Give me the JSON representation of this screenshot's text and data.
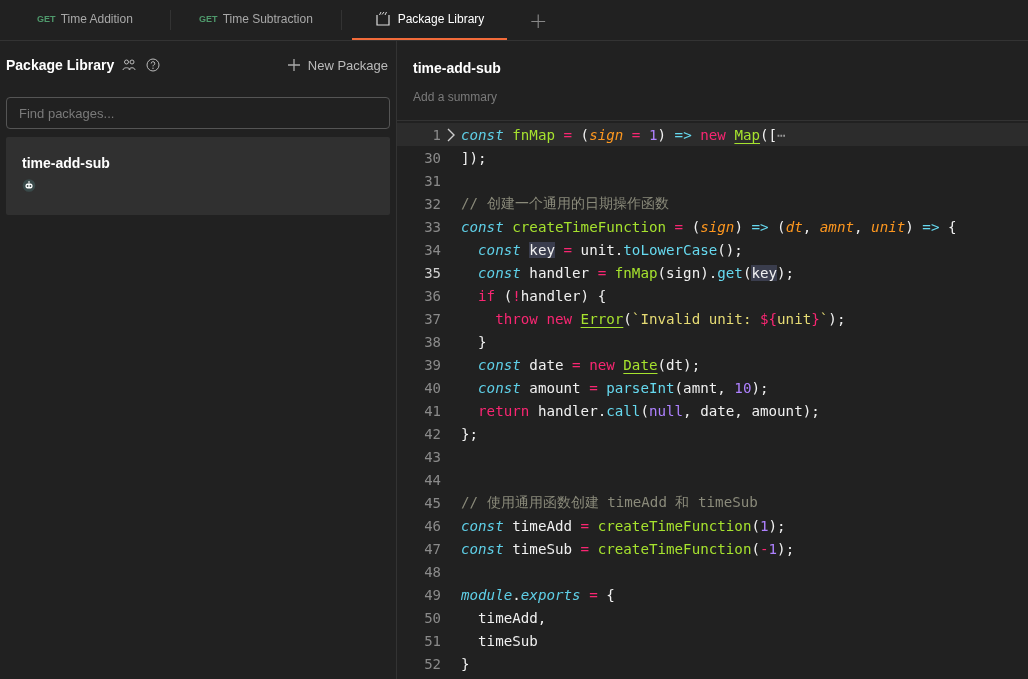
{
  "tabs": [
    {
      "kind": "request",
      "method": "GET",
      "label": "Time Addition",
      "selected": false
    },
    {
      "kind": "request",
      "method": "GET",
      "label": "Time Subtraction",
      "selected": false
    },
    {
      "kind": "package",
      "label": "Package Library",
      "selected": true
    }
  ],
  "new_tab": "+",
  "sidebar": {
    "title": "Package Library",
    "new_button": "New Package",
    "search": {
      "placeholder": "Find packages..."
    },
    "items": [
      {
        "name": "time-add-sub",
        "selected": true
      }
    ]
  },
  "editor": {
    "title": "time-add-sub",
    "summary_placeholder": "Add a summary",
    "lines": [
      {
        "number": "1",
        "folded": true,
        "highlighted": true,
        "active": false,
        "tokens": [
          {
            "kind": "kw",
            "text": "const"
          },
          {
            "kind": "fn",
            "text": " fnMap"
          },
          {
            "kind": "op",
            "text": " ="
          },
          {
            "kind": "pl",
            "text": " ("
          },
          {
            "kind": "par",
            "text": "sign"
          },
          {
            "kind": "op",
            "text": " ="
          },
          {
            "kind": "num",
            "text": " 1"
          },
          {
            "kind": "pl",
            "text": ")"
          },
          {
            "kind": "mth",
            "text": " =>"
          },
          {
            "kind": "kw2",
            "text": " new "
          },
          {
            "kind": "cls",
            "text": "Map"
          },
          {
            "kind": "pl",
            "text": "(["
          },
          {
            "kind": "dim",
            "text": "⋯"
          }
        ]
      },
      {
        "number": "30",
        "folded": false,
        "highlighted": false,
        "active": false,
        "tokens": [
          {
            "kind": "pl",
            "text": "]);"
          }
        ]
      },
      {
        "number": "31",
        "folded": false,
        "highlighted": false,
        "active": false
      },
      {
        "number": "32",
        "folded": false,
        "highlighted": false,
        "active": false,
        "tokens": [
          {
            "kind": "cm",
            "text": "// 创建一个通用的日期操作函数"
          }
        ]
      },
      {
        "number": "33",
        "folded": false,
        "highlighted": false,
        "active": false,
        "tokens": [
          {
            "kind": "kw",
            "text": "const"
          },
          {
            "kind": "fn",
            "text": " createTimeFunction"
          },
          {
            "kind": "op",
            "text": " ="
          },
          {
            "kind": "pl",
            "text": " ("
          },
          {
            "kind": "par",
            "text": "sign"
          },
          {
            "kind": "pl",
            "text": ")"
          },
          {
            "kind": "mth",
            "text": " =>"
          },
          {
            "kind": "pl",
            "text": " ("
          },
          {
            "kind": "par",
            "text": "dt"
          },
          {
            "kind": "pl",
            "text": ","
          },
          {
            "kind": "par",
            "text": " amnt"
          },
          {
            "kind": "pl",
            "text": ","
          },
          {
            "kind": "par",
            "text": " unit"
          },
          {
            "kind": "pl",
            "text": ")"
          },
          {
            "kind": "mth",
            "text": " =>"
          },
          {
            "kind": "pl",
            "text": " {"
          }
        ]
      },
      {
        "number": "34",
        "folded": false,
        "highlighted": false,
        "active": false,
        "tokens": [
          {
            "kind": "kw",
            "text": "  const "
          },
          {
            "kind": "hl",
            "text": "key"
          },
          {
            "kind": "op",
            "text": " ="
          },
          {
            "kind": "pl",
            "text": " unit."
          },
          {
            "kind": "mth",
            "text": "toLowerCase"
          },
          {
            "kind": "pl",
            "text": "();"
          }
        ]
      },
      {
        "number": "35",
        "folded": false,
        "highlighted": false,
        "active": true,
        "tokens": [
          {
            "kind": "kw",
            "text": "  const"
          },
          {
            "kind": "pl",
            "text": " handler"
          },
          {
            "kind": "op",
            "text": " ="
          },
          {
            "kind": "fn",
            "text": " fnMap"
          },
          {
            "kind": "pl",
            "text": "(sign)."
          },
          {
            "kind": "mth",
            "text": "get"
          },
          {
            "kind": "pl",
            "text": "("
          },
          {
            "kind": "hl",
            "text": "key"
          },
          {
            "kind": "pl",
            "text": ");"
          }
        ]
      },
      {
        "number": "36",
        "folded": false,
        "highlighted": false,
        "active": false,
        "tokens": [
          {
            "kind": "kw2",
            "text": "  if"
          },
          {
            "kind": "pl",
            "text": " ("
          },
          {
            "kind": "op",
            "text": "!"
          },
          {
            "kind": "pl",
            "text": "handler) {"
          }
        ]
      },
      {
        "number": "37",
        "folded": false,
        "highlighted": false,
        "active": false,
        "tokens": [
          {
            "kind": "kw2",
            "text": "    throw new "
          },
          {
            "kind": "cls",
            "text": "Error"
          },
          {
            "kind": "pl",
            "text": "("
          },
          {
            "kind": "str",
            "text": "`Invalid unit: "
          },
          {
            "kind": "op",
            "text": "${"
          },
          {
            "kind": "str",
            "text": "unit"
          },
          {
            "kind": "op",
            "text": "}"
          },
          {
            "kind": "str",
            "text": "`"
          },
          {
            "kind": "pl",
            "text": ");"
          }
        ]
      },
      {
        "number": "38",
        "folded": false,
        "highlighted": false,
        "active": false,
        "tokens": [
          {
            "kind": "pl",
            "text": "  }"
          }
        ]
      },
      {
        "number": "39",
        "folded": false,
        "highlighted": false,
        "active": false,
        "tokens": [
          {
            "kind": "kw",
            "text": "  const"
          },
          {
            "kind": "pl",
            "text": " date"
          },
          {
            "kind": "op",
            "text": " ="
          },
          {
            "kind": "kw2",
            "text": " new "
          },
          {
            "kind": "cls",
            "text": "Date"
          },
          {
            "kind": "pl",
            "text": "(dt);"
          }
        ]
      },
      {
        "number": "40",
        "folded": false,
        "highlighted": false,
        "active": false,
        "tokens": [
          {
            "kind": "kw",
            "text": "  const"
          },
          {
            "kind": "pl",
            "text": " amount"
          },
          {
            "kind": "op",
            "text": " ="
          },
          {
            "kind": "mth",
            "text": " parseInt"
          },
          {
            "kind": "pl",
            "text": "(amnt,"
          },
          {
            "kind": "num",
            "text": " 10"
          },
          {
            "kind": "pl",
            "text": ");"
          }
        ]
      },
      {
        "number": "41",
        "folded": false,
        "highlighted": false,
        "active": false,
        "tokens": [
          {
            "kind": "kw2",
            "text": "  return"
          },
          {
            "kind": "pl",
            "text": " handler."
          },
          {
            "kind": "mth",
            "text": "call"
          },
          {
            "kind": "pl",
            "text": "("
          },
          {
            "kind": "num",
            "text": "null"
          },
          {
            "kind": "pl",
            "text": ", date, amount);"
          }
        ]
      },
      {
        "number": "42",
        "folded": false,
        "highlighted": false,
        "active": false,
        "tokens": [
          {
            "kind": "pl",
            "text": "};"
          }
        ]
      },
      {
        "number": "43",
        "folded": false,
        "highlighted": false,
        "active": false
      },
      {
        "number": "44",
        "folded": false,
        "highlighted": false,
        "active": false
      },
      {
        "number": "45",
        "folded": false,
        "highlighted": false,
        "active": false,
        "tokens": [
          {
            "kind": "cm",
            "text": "// 使用通用函数创建 timeAdd 和 timeSub"
          }
        ]
      },
      {
        "number": "46",
        "folded": false,
        "highlighted": false,
        "active": false,
        "tokens": [
          {
            "kind": "kw",
            "text": "const"
          },
          {
            "kind": "pl",
            "text": " timeAdd"
          },
          {
            "kind": "op",
            "text": " ="
          },
          {
            "kind": "fn",
            "text": " createTimeFunction"
          },
          {
            "kind": "pl",
            "text": "("
          },
          {
            "kind": "num",
            "text": "1"
          },
          {
            "kind": "pl",
            "text": ");"
          }
        ]
      },
      {
        "number": "47",
        "folded": false,
        "highlighted": false,
        "active": false,
        "tokens": [
          {
            "kind": "kw",
            "text": "const"
          },
          {
            "kind": "pl",
            "text": " timeSub"
          },
          {
            "kind": "op",
            "text": " ="
          },
          {
            "kind": "fn",
            "text": " createTimeFunction"
          },
          {
            "kind": "pl",
            "text": "("
          },
          {
            "kind": "op",
            "text": "-"
          },
          {
            "kind": "num",
            "text": "1"
          },
          {
            "kind": "pl",
            "text": ");"
          }
        ]
      },
      {
        "number": "48",
        "folded": false,
        "highlighted": false,
        "active": false
      },
      {
        "number": "49",
        "folded": false,
        "highlighted": false,
        "active": false,
        "tokens": [
          {
            "kind": "kw",
            "text": "module"
          },
          {
            "kind": "pl",
            "text": "."
          },
          {
            "kind": "kw",
            "text": "exports"
          },
          {
            "kind": "op",
            "text": " ="
          },
          {
            "kind": "pl",
            "text": " {"
          }
        ]
      },
      {
        "number": "50",
        "folded": false,
        "highlighted": false,
        "active": false,
        "tokens": [
          {
            "kind": "pl",
            "text": "  timeAdd,"
          }
        ]
      },
      {
        "number": "51",
        "folded": false,
        "highlighted": false,
        "active": false,
        "tokens": [
          {
            "kind": "pl",
            "text": "  timeSub"
          }
        ]
      },
      {
        "number": "52",
        "folded": false,
        "highlighted": false,
        "active": false,
        "tokens": [
          {
            "kind": "pl",
            "text": "}"
          }
        ]
      }
    ]
  }
}
